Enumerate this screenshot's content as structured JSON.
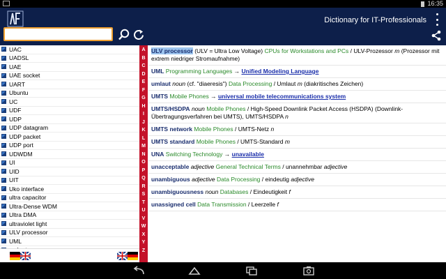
{
  "status": {
    "time": "16:35"
  },
  "app": {
    "title": "Dictionary for IT-Professionals"
  },
  "search": {
    "value": "",
    "placeholder": ""
  },
  "list": {
    "items": [
      "UAC",
      "UADSL",
      "UAE",
      "UAE socket",
      "UART",
      "Ubuntu",
      "UC",
      "UDF",
      "UDP",
      "UDP datagram",
      "UDP packet",
      "UDP port",
      "UDWDM",
      "UI",
      "UID",
      "UIT",
      "Uko interface",
      "ultra capacitor",
      "Ultra-Dense WDM",
      "Ultra DMA",
      "ultraviolet light",
      "ULV processor",
      "UML",
      "umlaut"
    ]
  },
  "alphabet": [
    "A",
    "B",
    "C",
    "D",
    "E",
    "F",
    "G",
    "H",
    "I",
    "J",
    "K",
    "L",
    "M",
    "N",
    "O",
    "P",
    "Q",
    "R",
    "S",
    "T",
    "U",
    "V",
    "W",
    "X",
    "Y",
    "Z"
  ],
  "entries": [
    {
      "hw": "ULV processor",
      "sel": true,
      "extra": " (ULV = Ultra Low Voltage) ",
      "cat": "CPUs for Workstations and PCs",
      "tr": " / ULV-Prozessor ",
      "pos": "m",
      "tail": " (Prozessor mit extrem niedriger Stromaufnahme)"
    },
    {
      "hw": "UML",
      "cat": "Programming Languages",
      "link": "Unified Modeling Language"
    },
    {
      "hw": "umlaut",
      "pos0": "noun",
      "extra": " (cf. \"diaeresis\") ",
      "cat": "Data Processing",
      "tr": " / Umlaut ",
      "pos": "m",
      "tail": " (diakritisches Zeichen)"
    },
    {
      "hw": "UMTS",
      "cat": "Mobile Phones",
      "link": "universal mobile telecommunications system"
    },
    {
      "hw": "UMTS/HSDPA",
      "pos0": "noun",
      "cat": "Mobile Phones",
      "tr": " / High-Speed Downlink Packet Access (HSDPA) (Downlink-Übertragungsverfahren bei UMTS), UMTS/HSDPA ",
      "pos": "n"
    },
    {
      "hw": "UMTS network",
      "cat": "Mobile Phones",
      "tr": " / UMTS-Netz ",
      "pos": "n"
    },
    {
      "hw": "UMTS standard",
      "cat": "Mobile Phones",
      "tr": " / UMTS-Standard ",
      "pos": "m"
    },
    {
      "hw": "UNA",
      "cat": "Switching Technology",
      "link": "unavailable"
    },
    {
      "hw": "unacceptable",
      "pos0": "adjective",
      "cat": "General Technical Terms",
      "tr": " / unannehmbar ",
      "pos": "adjective"
    },
    {
      "hw": "unambiguous",
      "pos0": "adjective",
      "cat": "Data Processing",
      "tr": " / eindeutig ",
      "pos": "adjective"
    },
    {
      "hw": "unambiguousness",
      "pos0": "noun",
      "cat": "Databases",
      "tr": " / Eindeutigkeit ",
      "pos": "f"
    },
    {
      "hw": "unassigned cell",
      "cat": "Data Transmission",
      "tr": " / Leerzelle ",
      "pos": "f"
    }
  ],
  "colors": {
    "actionbar": "#0d1f4a",
    "alphabar": "#c4122a",
    "category": "#2a8a2a",
    "search_border": "#f0a030"
  }
}
